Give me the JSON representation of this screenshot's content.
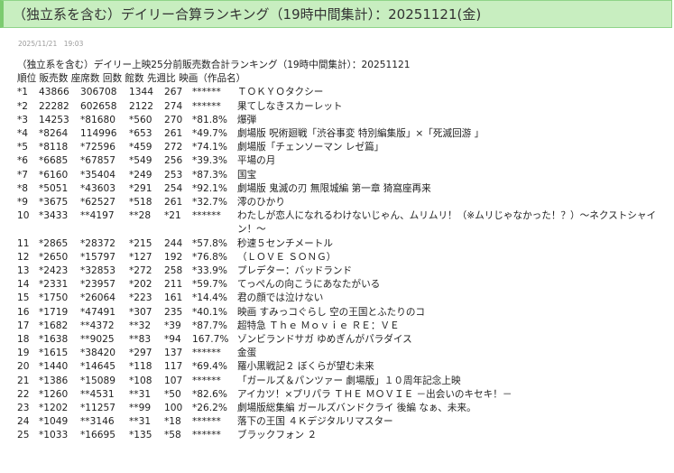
{
  "article": {
    "title": "（独立系を含む）デイリー合算ランキング（19時中間集計）：20251121(金)",
    "date": "2025/11/21　19:03"
  },
  "ranking": {
    "heading": "（独立系を含む）デイリー上映25分前販売数合計ランキング（19時中間集計）：20251121",
    "columns": "順位 販売数 座席数 回数 館数 先週比 映画（作品名）",
    "rows": [
      [
        "*1",
        "43866",
        "306708",
        "1344",
        "267",
        "******",
        "ＴＯＫＹＯタクシー"
      ],
      [
        "*2",
        "22282",
        "602658",
        "2122",
        "274",
        "******",
        "果てしなきスカーレット"
      ],
      [
        "*3",
        "14253",
        "*81680",
        "*560",
        "270",
        "*81.8%",
        "爆弾"
      ],
      [
        "*4",
        "*8264",
        "114996",
        "*653",
        "261",
        "*49.7%",
        "劇場版 呪術廻戦「渋谷事変 特別編集版」×「死滅回游 」"
      ],
      [
        "*5",
        "*8118",
        "*72596",
        "*459",
        "272",
        "*74.1%",
        "劇場版「チェンソーマン レゼ篇」"
      ],
      [
        "*6",
        "*6685",
        "*67857",
        "*549",
        "256",
        "*39.3%",
        "平場の月"
      ],
      [
        "*7",
        "*6160",
        "*35404",
        "*249",
        "253",
        "*87.3%",
        "国宝"
      ],
      [
        "*8",
        "*5051",
        "*43603",
        "*291",
        "254",
        "*92.1%",
        "劇場版 鬼滅の刃 無限城編 第一章 猗窩座再来"
      ],
      [
        "*9",
        "*3675",
        "*62527",
        "*518",
        "261",
        "*32.7%",
        "澪のひかり"
      ],
      [
        "10",
        "*3433",
        "**4197",
        "**28",
        "*21",
        "******",
        "わたしが恋人になれるわけないじゃん、ムリムリ！（※ムリじゃなかった！？）～ネクストシャイン！～"
      ],
      [
        "11",
        "*2865",
        "*28372",
        "*215",
        "244",
        "*57.8%",
        "秒速５センチメートル"
      ],
      [
        "12",
        "*2650",
        "*15797",
        "*127",
        "192",
        "*76.8%",
        "（ＬＯＶＥ ＳＯＮＧ）"
      ],
      [
        "13",
        "*2423",
        "*32853",
        "*272",
        "258",
        "*33.9%",
        "プレデター：バッドランド"
      ],
      [
        "14",
        "*2331",
        "*23957",
        "*202",
        "211",
        "*59.7%",
        "てっぺんの向こうにあなたがいる"
      ],
      [
        "15",
        "*1750",
        "*26064",
        "*223",
        "161",
        "*14.4%",
        "君の顔では泣けない"
      ],
      [
        "16",
        "*1719",
        "*47491",
        "*307",
        "235",
        "*40.1%",
        "映画 すみっコぐらし 空の王国とふたりのコ"
      ],
      [
        "17",
        "*1682",
        "**4372",
        "**32",
        "*39",
        "*87.7%",
        "超特急 Ｔｈｅ Ｍｏｖｉｅ ＲＥ：ＶＥ"
      ],
      [
        "18",
        "*1638",
        "**9025",
        "**83",
        "*94",
        "167.7%",
        "ゾンビランドサガ ゆめぎんがパラダイス"
      ],
      [
        "19",
        "*1615",
        "*38420",
        "*297",
        "137",
        "******",
        "金蛋"
      ],
      [
        "20",
        "*1440",
        "*14645",
        "*118",
        "117",
        "*69.4%",
        "羅小黒戦記２ ぼくらが望む未来"
      ],
      [
        "21",
        "*1386",
        "*15089",
        "*108",
        "107",
        "******",
        "「ガールズ＆パンツァー 劇場版」１０周年記念上映"
      ],
      [
        "22",
        "*1260",
        "**4531",
        "**31",
        "*50",
        "*82.6%",
        "アイカツ！×プリパラ ＴＨＥ ＭＯＶＩＥ －出会いのキセキ！－"
      ],
      [
        "23",
        "*1202",
        "*11257",
        "**99",
        "100",
        "*26.2%",
        "劇場版総集編 ガールズバンドクライ 後編 なぁ、未来。"
      ],
      [
        "24",
        "*1049",
        "**3146",
        "**31",
        "*18",
        "******",
        "落下の王国 ４Ｋデジタルリマスター"
      ],
      [
        "25",
        "*1033",
        "*16695",
        "*135",
        "*58",
        "******",
        "ブラックフォン ２"
      ]
    ]
  }
}
